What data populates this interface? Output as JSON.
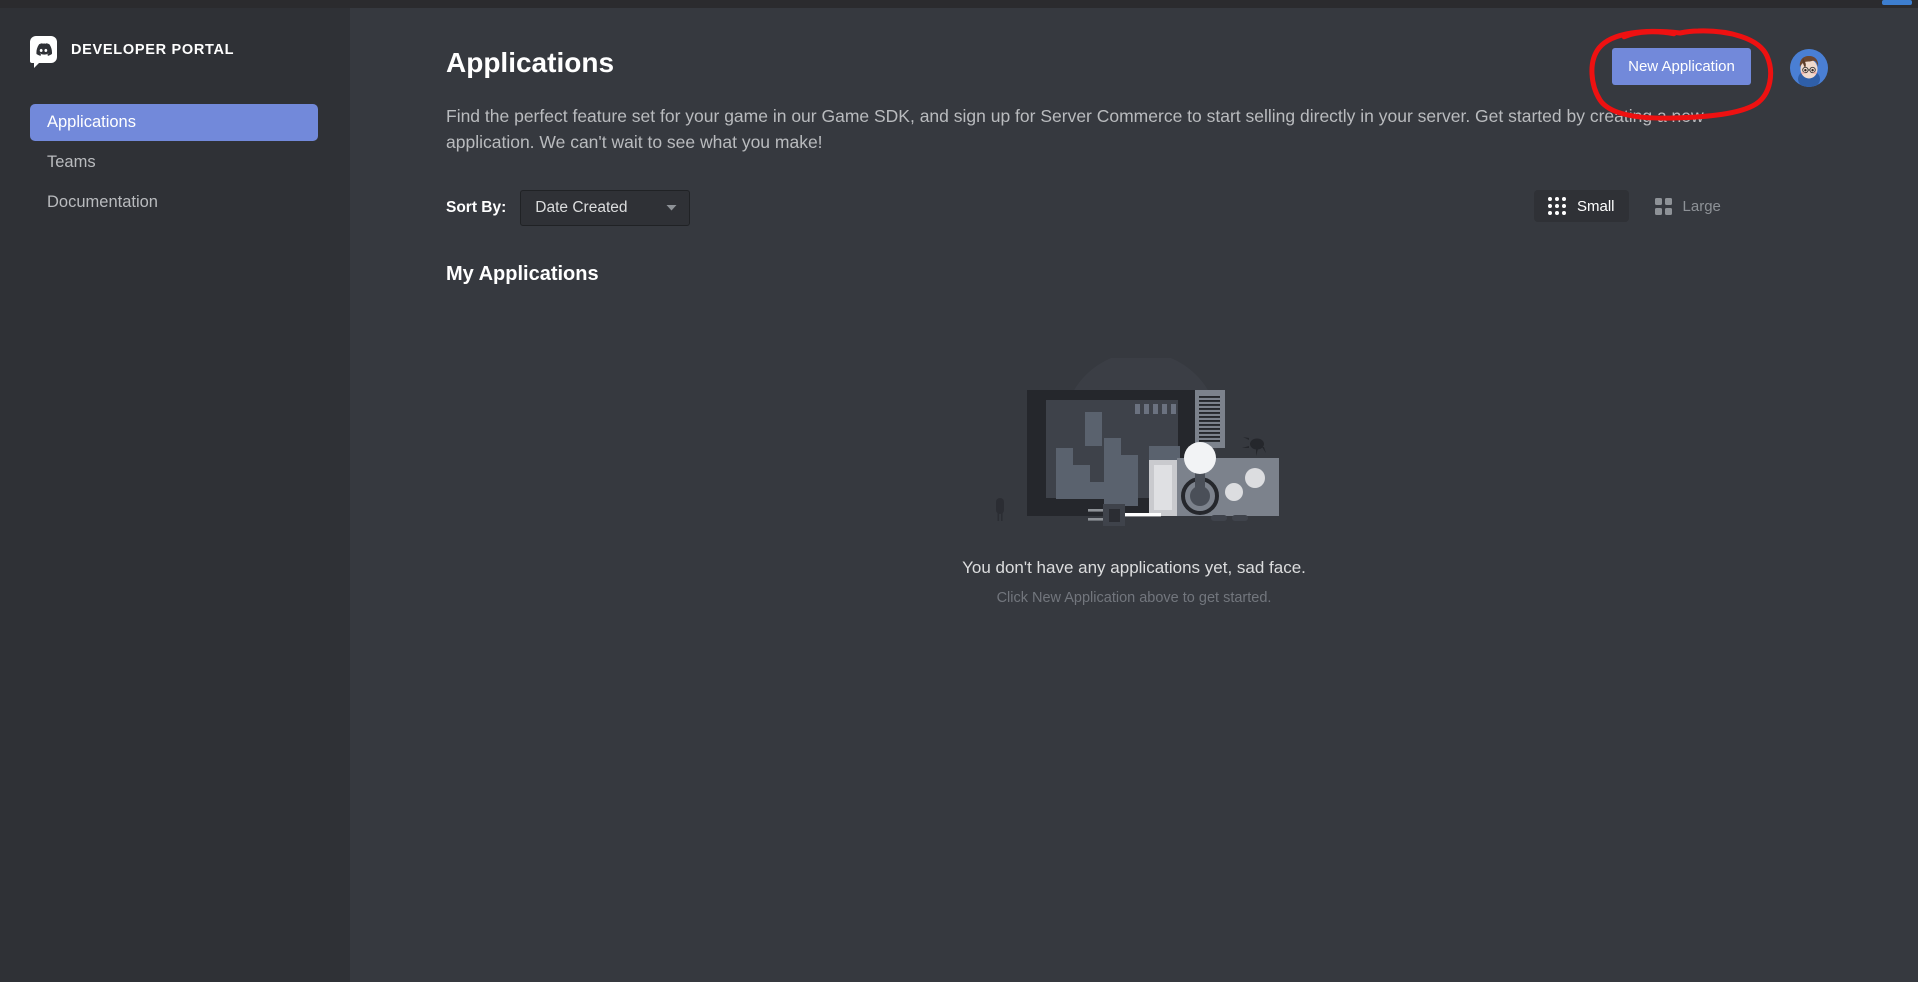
{
  "brand": {
    "title": "DEVELOPER PORTAL",
    "logo_icon": "discord-clyde-icon"
  },
  "sidebar": {
    "items": [
      {
        "label": "Applications",
        "active": true
      },
      {
        "label": "Teams",
        "active": false
      },
      {
        "label": "Documentation",
        "active": false
      }
    ]
  },
  "header": {
    "title": "Applications",
    "description": "Find the perfect feature set for your game in our Game SDK, and sign up for Server Commerce to start selling directly in your server. Get started by creating a new application. We can't wait to see what you make!",
    "new_application_label": "New Application",
    "avatar_icon": "user-avatar",
    "annotation_color": "#ee1111"
  },
  "toolbar": {
    "sort_label": "Sort By:",
    "sort_value": "Date Created",
    "sort_options": [
      "Date Created"
    ],
    "caret_icon": "chevron-down-icon",
    "views": [
      {
        "label": "Small",
        "icon": "dot-grid-icon",
        "active": true
      },
      {
        "label": "Large",
        "icon": "square-grid-icon",
        "active": false
      }
    ]
  },
  "main": {
    "section_heading": "My Applications",
    "empty_state": {
      "illustration_icon": "arcade-machine-illustration",
      "title": "You don't have any applications yet, sad face.",
      "subtitle": "Click New Application above to get started."
    }
  },
  "colors": {
    "accent": "#7289da",
    "sidebar_bg": "#2f3136",
    "main_bg": "#36393f",
    "text_primary": "#ffffff",
    "text_muted": "#b9bbbe",
    "text_dim": "#72767d",
    "annotation": "#ee1111",
    "scroll_thumb": "#3d7ecf"
  }
}
